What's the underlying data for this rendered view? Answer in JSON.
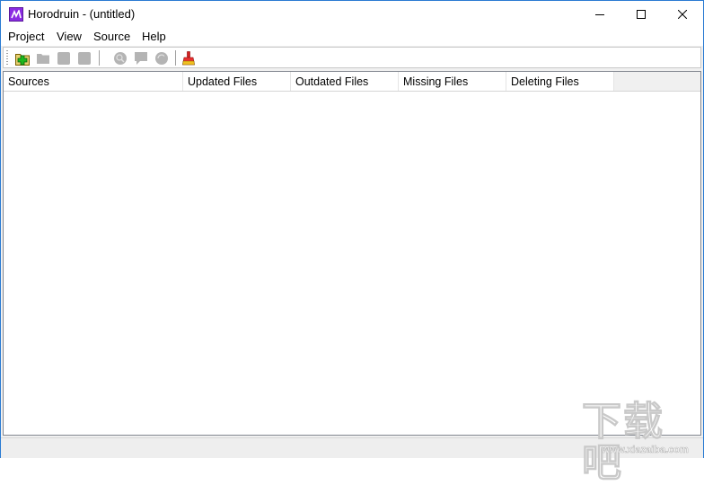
{
  "window": {
    "title": "Horodruin - (untitled)",
    "controls": {
      "minimize": "minimize-icon",
      "maximize": "maximize-icon",
      "close": "close-icon"
    }
  },
  "menubar": {
    "items": [
      {
        "label": "Project"
      },
      {
        "label": "View"
      },
      {
        "label": "Source"
      },
      {
        "label": "Help"
      }
    ]
  },
  "toolbar": {
    "buttons": [
      {
        "icon": "add-project-icon",
        "enabled": true
      },
      {
        "icon": "open-folder-icon",
        "enabled": false
      },
      {
        "icon": "save-icon",
        "enabled": false
      },
      {
        "icon": "save-as-icon",
        "enabled": false
      },
      {
        "icon": "scan-icon",
        "enabled": false
      },
      {
        "icon": "comment-icon",
        "enabled": false
      },
      {
        "icon": "refresh-icon",
        "enabled": false
      },
      {
        "icon": "clean-brush-icon",
        "enabled": true
      }
    ]
  },
  "table": {
    "columns": [
      {
        "label": "Sources"
      },
      {
        "label": "Updated Files"
      },
      {
        "label": "Outdated Files"
      },
      {
        "label": "Missing Files"
      },
      {
        "label": "Deleting Files"
      }
    ],
    "rows": []
  },
  "statusbar": {
    "text": ""
  },
  "watermark": {
    "title": "下载吧",
    "url": "www.xiazaiba.com"
  }
}
